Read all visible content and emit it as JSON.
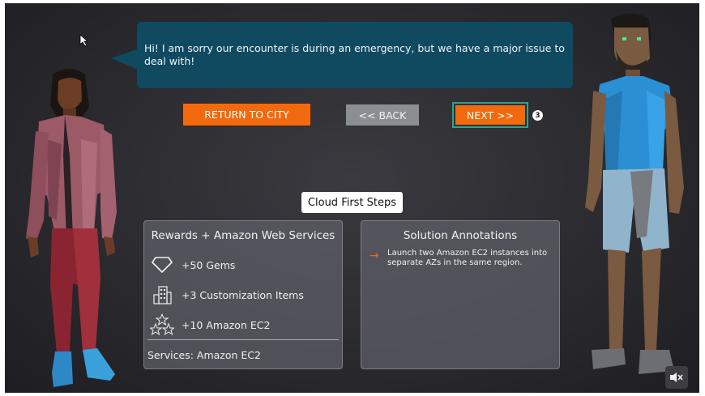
{
  "dialog": {
    "text": "Hi! I am sorry our encounter is during an emergency, but we have a major issue to deal with!"
  },
  "buttons": {
    "return_label": "RETURN TO CITY",
    "back_label": "<< BACK",
    "next_label": "NEXT >>",
    "step_badge": "3"
  },
  "title_tag": "Cloud First Steps",
  "rewards": {
    "title": "Rewards + Amazon Web Services",
    "items": [
      {
        "icon": "gem-icon",
        "label": "+50 Gems"
      },
      {
        "icon": "buildings-icon",
        "label": "+3 Customization Items"
      },
      {
        "icon": "stars-icon",
        "label": "+10 Amazon EC2"
      }
    ],
    "services": "Services: Amazon EC2"
  },
  "solution": {
    "title": "Solution Annotations",
    "annotation": "Launch two Amazon EC2 instances into separate AZs in the same region.",
    "arrow_color": "#f26a0d"
  },
  "colors": {
    "accent_orange": "#f26a0d",
    "bubble": "#0f4a60",
    "highlight_teal": "#1fa79a"
  }
}
